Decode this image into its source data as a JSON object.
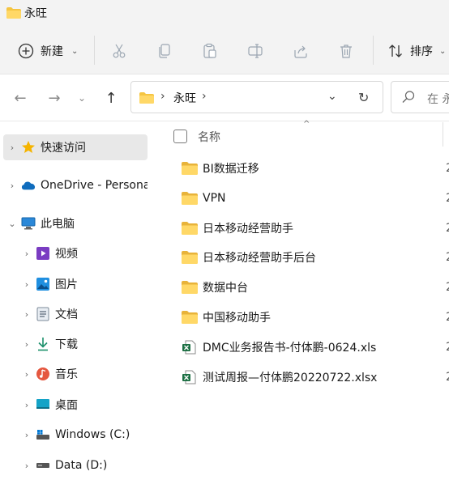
{
  "window": {
    "title": "永旺",
    "folder_icon": "folder-icon"
  },
  "toolbar": {
    "new_label": "新建",
    "new_chevron": "⌄",
    "sort_label": "排序",
    "sort_chevron": "⌄",
    "tools": [
      "cut-icon",
      "copy-icon",
      "paste-icon",
      "rename-icon",
      "share-icon",
      "delete-icon"
    ]
  },
  "address": {
    "back": "←",
    "forward": "→",
    "recent": "⌄",
    "up": "↑",
    "sep1": "›",
    "crumb": "永旺",
    "sep2": "›",
    "dropdown": "⌄",
    "refresh": "↻",
    "search_placeholder": "在 永"
  },
  "nav": {
    "items": [
      {
        "label": "快速访问",
        "icon": "star-icon",
        "arrow": "›",
        "selected": true
      },
      {
        "label": "OneDrive - Persona",
        "icon": "onedrive-cloud-icon",
        "arrow": "›"
      },
      {
        "label": "此电脑",
        "icon": "pc-icon",
        "arrow": "⌄"
      },
      {
        "label": "视频",
        "icon": "video-icon",
        "arrow": "›"
      },
      {
        "label": "图片",
        "icon": "pictures-icon",
        "arrow": "›"
      },
      {
        "label": "文档",
        "icon": "documents-icon",
        "arrow": "›"
      },
      {
        "label": "下载",
        "icon": "download-icon",
        "arrow": "›"
      },
      {
        "label": "音乐",
        "icon": "music-icon",
        "arrow": "›"
      },
      {
        "label": "桌面",
        "icon": "desktop-icon",
        "arrow": "›"
      },
      {
        "label": "Windows (C:)",
        "icon": "drive-c-icon",
        "arrow": "›"
      },
      {
        "label": "Data (D:)",
        "icon": "drive-d-icon",
        "arrow": "›"
      }
    ]
  },
  "files": {
    "column_name": "名称",
    "sort_indicator": "^",
    "rows": [
      {
        "name": "BI数据迁移",
        "type": "folder",
        "date": "2"
      },
      {
        "name": "VPN",
        "type": "folder",
        "date": "2"
      },
      {
        "name": "日本移动经营助手",
        "type": "folder",
        "date": "2"
      },
      {
        "name": "日本移动经营助手后台",
        "type": "folder",
        "date": "2"
      },
      {
        "name": "数据中台",
        "type": "folder",
        "date": "2"
      },
      {
        "name": "中国移动助手",
        "type": "folder",
        "date": "2"
      },
      {
        "name": "DMC业务报告书-付体鹏-0624.xls",
        "type": "excel",
        "date": "2"
      },
      {
        "name": "测试周报—付体鹏20220722.xlsx",
        "type": "excel",
        "date": "2"
      }
    ]
  },
  "colors": {
    "folder": "#f5c542",
    "folder_dark": "#e0a92a",
    "excel": "#1d7044",
    "accent": "#0067c0"
  }
}
